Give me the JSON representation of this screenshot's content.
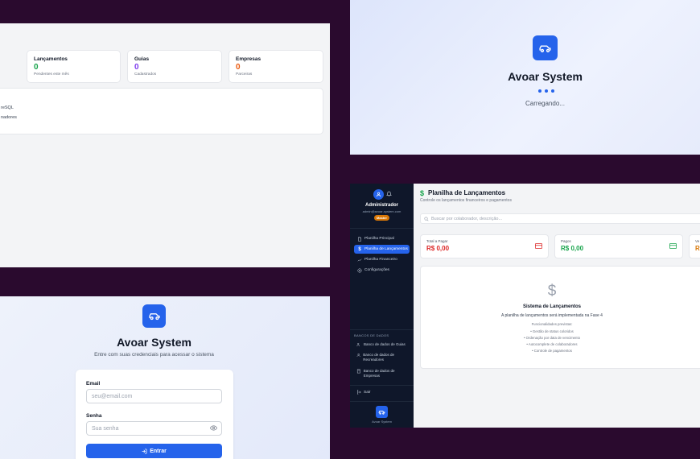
{
  "dashboard": {
    "cards": [
      {
        "title": "Lançamentos",
        "value": "0",
        "sub": "Pendentes este mês",
        "color": "#16a34a"
      },
      {
        "title": "Guias",
        "value": "0",
        "sub": "Cadastrados",
        "color": "#7c3aed"
      },
      {
        "title": "Empresas",
        "value": "0",
        "sub": "Parceiras",
        "color": "#ea580c"
      }
    ],
    "info_lines": [
      "reSQL",
      "nadores"
    ]
  },
  "loading": {
    "title": "Avoar System",
    "text": "Carregando..."
  },
  "login": {
    "title": "Avoar System",
    "subtitle": "Entre com suas credenciais para acessar o sistema",
    "email_label": "Email",
    "email_placeholder": "seu@email.com",
    "password_label": "Senha",
    "password_placeholder": "Sua senha",
    "submit_label": "Entrar"
  },
  "app": {
    "user": {
      "name": "Administrador",
      "email": "admin@avoar-system.com",
      "role": "Master"
    },
    "nav": [
      {
        "label": "Planilha Principal",
        "icon": "file-icon",
        "active": false
      },
      {
        "label": "Planilha de Lançamentos",
        "icon": "dollar-icon",
        "active": true
      },
      {
        "label": "Planilha Financeiro",
        "icon": "trend-icon",
        "active": false
      },
      {
        "label": "Configurações",
        "icon": "settings-icon",
        "active": false
      }
    ],
    "db_section": "BANCOS DE DADOS",
    "db_items": [
      {
        "label": "Banco de dados de Guias",
        "icon": "users-icon"
      },
      {
        "label": "Banco de dados de Recreadores",
        "icon": "user-icon"
      },
      {
        "label": "Banco de dados de Empresas",
        "icon": "building-icon"
      }
    ],
    "exit_label": "Sair",
    "footer_name": "Avoar System",
    "page_title": "Planilha de Lançamentos",
    "page_subtitle": "Controle os lançamentos financeiros e pagamentos",
    "search_placeholder": "Buscar por colaborador, descrição...",
    "cards": [
      {
        "title": "Total a Pagar",
        "value": "R$ 0,00",
        "color": "#dc2626"
      },
      {
        "title": "Pagos",
        "value": "R$ 0,00",
        "color": "#16a34a"
      },
      {
        "title": "Ve",
        "value": "R$",
        "color": "#d97706"
      }
    ],
    "main_title": "Sistema de Lançamentos",
    "main_desc": "A planilha de lançamentos será implementada na Fase 4",
    "funcs_title": "Funcionalidades previstas:",
    "features": [
      "• Gestão de status coloridos",
      "• Ordenação por data de vencimento",
      "• Autocomplete de colaboradores",
      "• Controle de pagamentos"
    ]
  }
}
